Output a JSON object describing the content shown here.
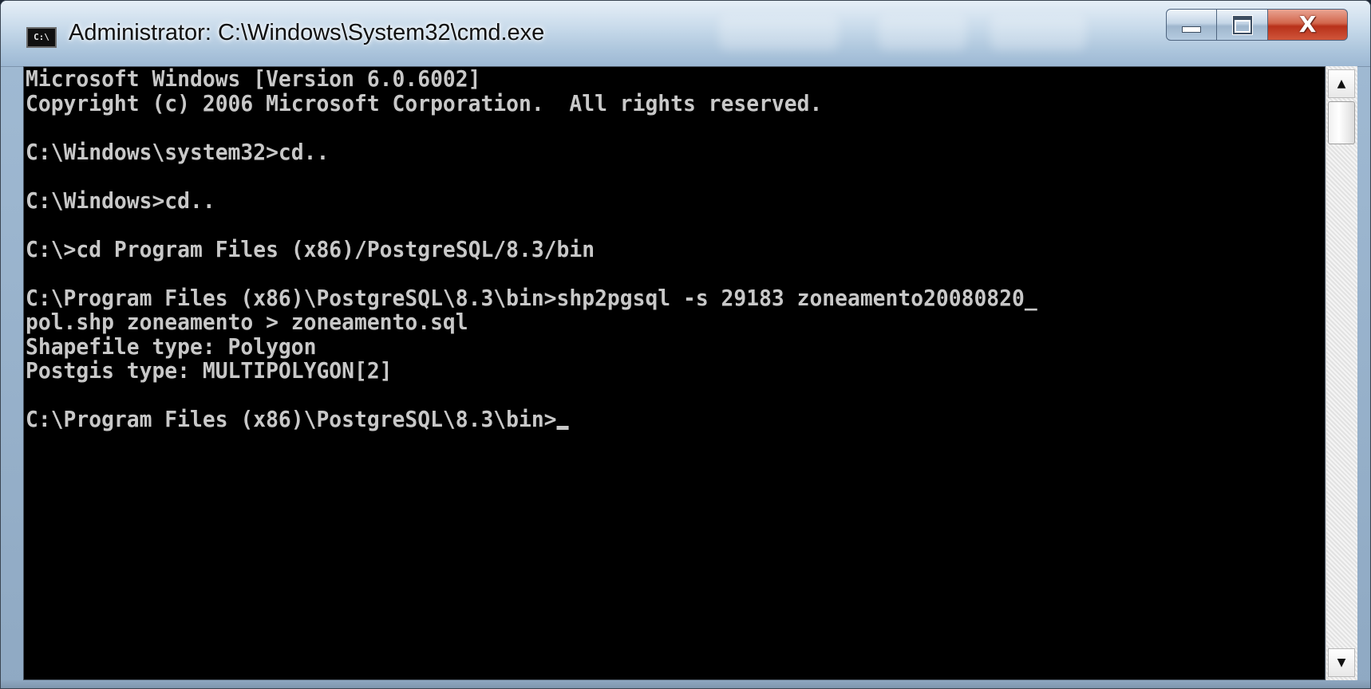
{
  "window": {
    "title": "Administrator: C:\\Windows\\System32\\cmd.exe",
    "icon_text": "C:\\",
    "icon_name": "cmd-icon"
  },
  "caption_buttons": {
    "minimize_icon": "minimize-icon",
    "maximize_icon": "maximize-icon",
    "close_icon": "close-icon",
    "close_glyph": "X"
  },
  "console": {
    "lines": [
      "Microsoft Windows [Version 6.0.6002]",
      "Copyright (c) 2006 Microsoft Corporation.  All rights reserved.",
      "",
      "C:\\Windows\\system32>cd..",
      "",
      "C:\\Windows>cd..",
      "",
      "C:\\>cd Program Files (x86)/PostgreSQL/8.3/bin",
      "",
      "C:\\Program Files (x86)\\PostgreSQL\\8.3\\bin>shp2pgsql -s 29183 zoneamento20080820_",
      "pol.shp zoneamento > zoneamento.sql",
      "Shapefile type: Polygon",
      "Postgis type: MULTIPOLYGON[2]",
      "",
      "C:\\Program Files (x86)\\PostgreSQL\\8.3\\bin>"
    ],
    "background_color": "#000000",
    "text_color": "#c8c8c8"
  },
  "scrollbar": {
    "up_arrow": "▲",
    "down_arrow": "▼"
  }
}
